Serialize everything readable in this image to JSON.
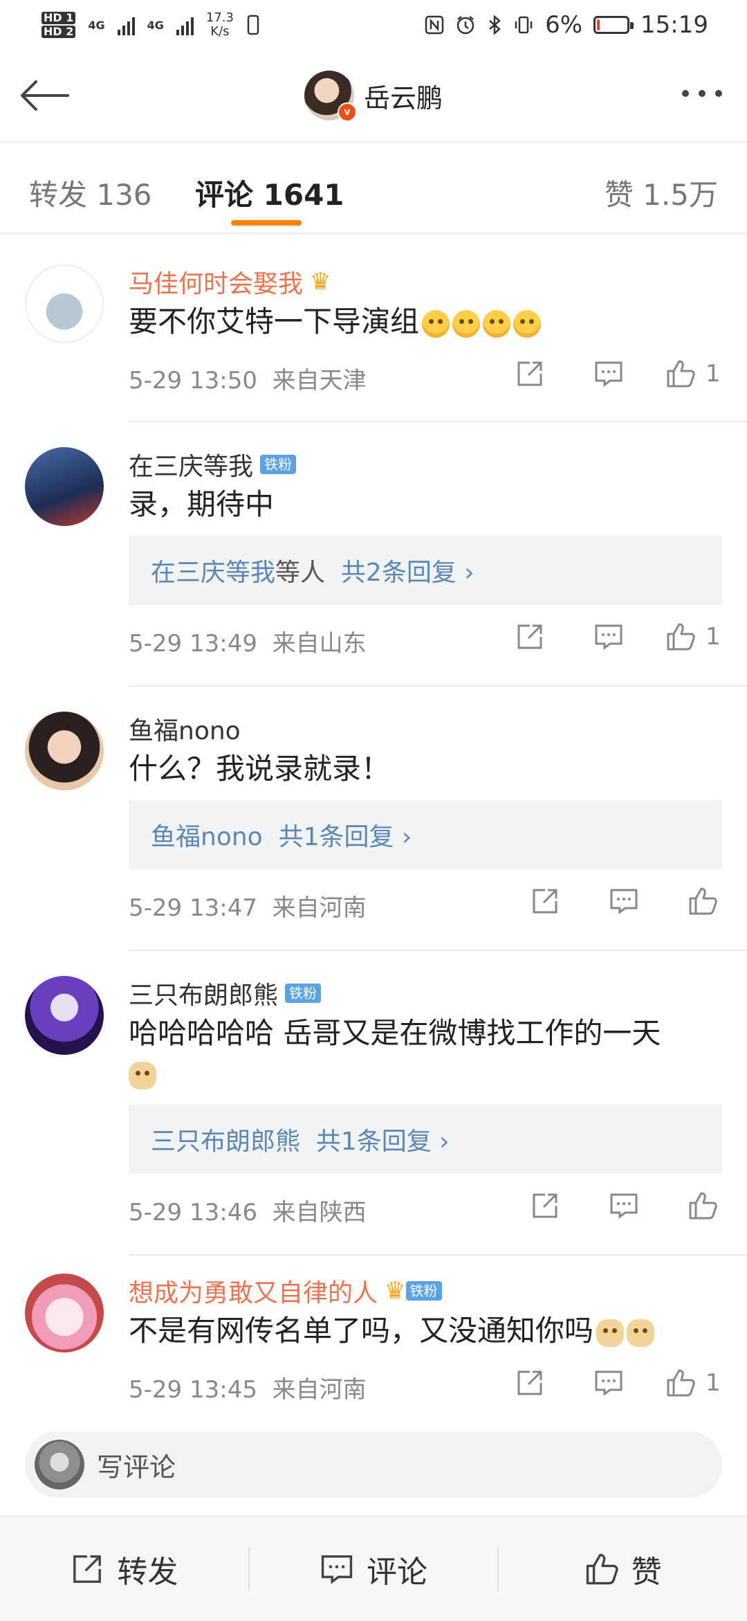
{
  "status_bar": {
    "hd1": "HD 1",
    "hd2": "HD 2",
    "net1": "4G",
    "net2": "4G",
    "speed": "17.3\nK/s",
    "battery_pct": "6%",
    "battery_level": 0.06,
    "time": "15:19"
  },
  "header": {
    "title": "岳云鹏",
    "avatar_badge": "v"
  },
  "tabs": {
    "repost": "转发 136",
    "comments": "评论 1641",
    "likes": "赞 1.5万"
  },
  "comments": [
    {
      "name": "马佳何时会娶我",
      "badge": "",
      "crown": "♛",
      "text": "要不你艾特一下导演组",
      "emoji_count": 4,
      "reply_link": "",
      "reply_rest": "",
      "reply_count": "",
      "time": "5-29 13:50",
      "location": "来自天津",
      "likes": "1"
    },
    {
      "name": "在三庆等我",
      "badge": "铁粉",
      "crown": "",
      "text": "录，期待中",
      "emoji_count": 0,
      "reply_link": "在三庆等我",
      "reply_rest": "等人",
      "reply_count": "共2条回复 ›",
      "time": "5-29 13:49",
      "location": "来自山东",
      "likes": "1"
    },
    {
      "name": "鱼福nono",
      "badge": "",
      "crown": "",
      "text": "什么？我说录就录！",
      "emoji_count": 0,
      "reply_link": "鱼福nono",
      "reply_rest": "",
      "reply_count": "共1条回复 ›",
      "time": "5-29 13:47",
      "location": "来自河南",
      "likes": ""
    },
    {
      "name": "三只布朗郎熊",
      "badge": "铁粉",
      "crown": "",
      "text": "哈哈哈哈哈 岳哥又是在微博找工作的一天",
      "emoji_count": 1,
      "reply_link": "三只布朗郎熊",
      "reply_rest": "",
      "reply_count": "共1条回复 ›",
      "time": "5-29 13:46",
      "location": "来自陕西",
      "likes": ""
    },
    {
      "name": "想成为勇敢又自律的人",
      "badge": "铁粉",
      "crown": "♛",
      "text": "不是有网传名单了吗，又没通知你吗",
      "emoji_count": 2,
      "reply_link": "",
      "reply_rest": "",
      "reply_count": "",
      "time": "5-29 13:45",
      "location": "来自河南",
      "likes": "1"
    }
  ],
  "compose": {
    "placeholder": "写评论"
  },
  "bottom_bar": {
    "repost": "转发",
    "comment": "评论",
    "like": "赞"
  },
  "colors": {
    "accent": "#ff8200",
    "vip_name": "#eb7350",
    "link": "#5b87b5",
    "tiefen": "#5aa2e6"
  }
}
